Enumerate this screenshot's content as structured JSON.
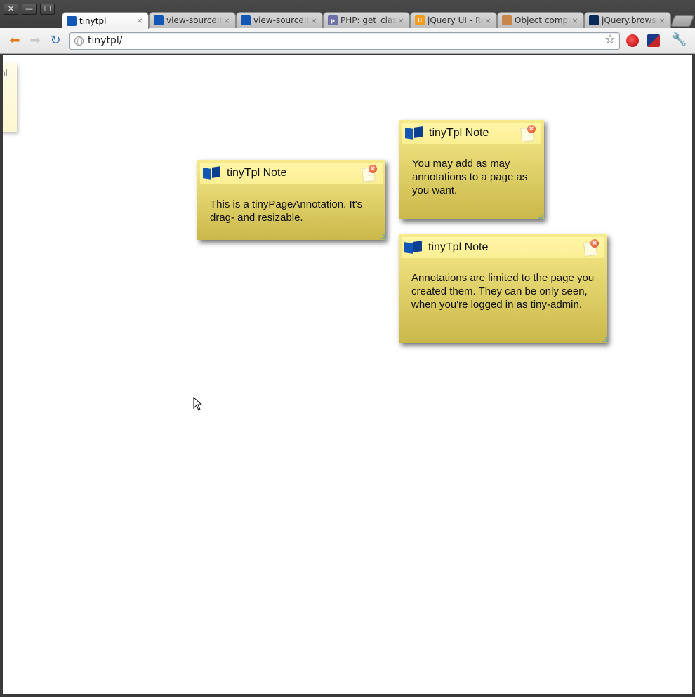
{
  "window": {
    "controls": {
      "close": "✕",
      "minimize": "—",
      "maximize": "☐"
    }
  },
  "tabs": [
    {
      "label": "tinytpl",
      "favicon": "tinytpl-icon",
      "active": true
    },
    {
      "label": "view-source:tiny",
      "favicon": "tinytpl-icon",
      "active": false
    },
    {
      "label": "view-source:tiny",
      "favicon": "tinytpl-icon",
      "active": false
    },
    {
      "label": "PHP: get_class",
      "favicon": "php-icon",
      "active": false
    },
    {
      "label": "jQuery UI - Res",
      "favicon": "jqueryui-icon",
      "active": false
    },
    {
      "label": "Object compa",
      "favicon": "stackoverflow-icon",
      "active": false
    },
    {
      "label": "jQuery.browser",
      "favicon": "jquery-icon",
      "active": false
    }
  ],
  "tab_close_glyph": "×",
  "toolbar": {
    "back_glyph": "⬅",
    "forward_glyph": "➡",
    "reload_glyph": "↻",
    "url": "tinytpl/",
    "star_glyph": "☆",
    "wrench_glyph": "🔧"
  },
  "partial_note": {
    "text": "pl"
  },
  "notes": [
    {
      "title": "tinyTpl Note",
      "body": "This is a tinyPageAnnotation. It's drag- and resizable."
    },
    {
      "title": "tinyTpl Note",
      "body": "You may add as may annotations to a page as you want."
    },
    {
      "title": "tinyTpl Note",
      "body": "Annotations are limited to the page you created them. They can be only seen, when you're logged in as tiny-admin."
    }
  ],
  "colors": {
    "note_top": "#f7ea8a",
    "note_bottom": "#c9b84a",
    "note_header": "#fff6a8",
    "book_icon": "#1357b6"
  }
}
